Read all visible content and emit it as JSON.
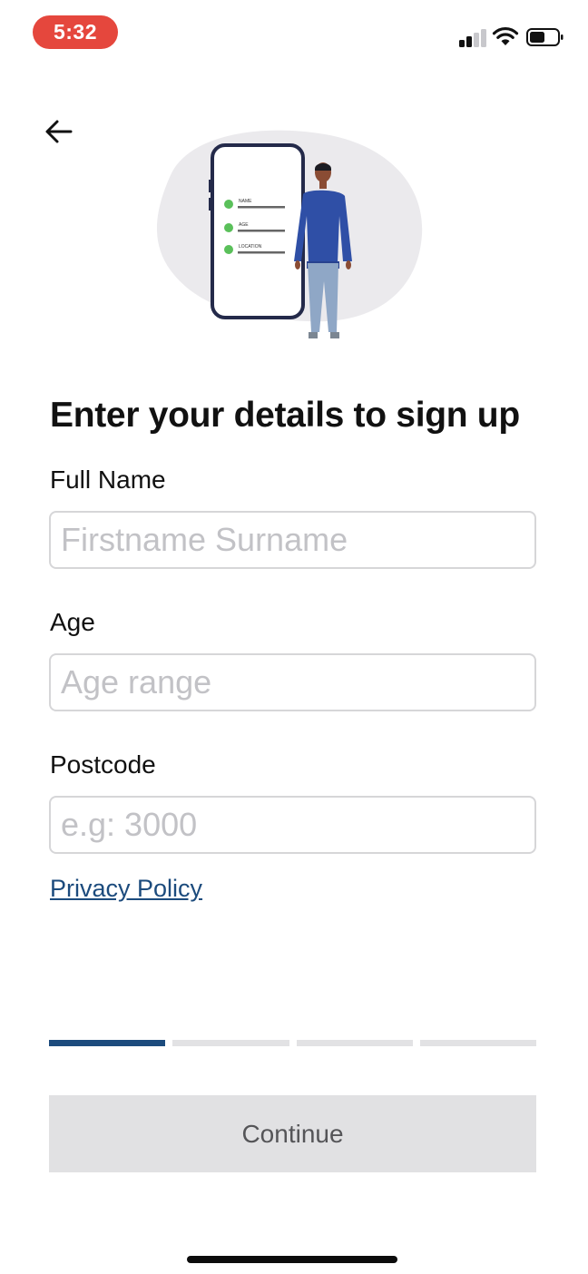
{
  "status_bar": {
    "time": "5:32",
    "icons": [
      "cellular-signal-icon",
      "wifi-icon",
      "battery-icon"
    ],
    "time_pill_color": "#e5473d"
  },
  "navigation": {
    "back_icon": "arrow-left-icon"
  },
  "illustration": {
    "checklist": [
      "NAME",
      "AGE",
      "LOCATION"
    ],
    "check_color": "#5ac05a"
  },
  "page": {
    "title": "Enter your details to sign up"
  },
  "form": {
    "full_name": {
      "label": "Full Name",
      "value": "",
      "placeholder": "Firstname Surname"
    },
    "age": {
      "label": "Age",
      "value": "",
      "placeholder": "Age range"
    },
    "postcode": {
      "label": "Postcode",
      "value": "",
      "placeholder": "e.g: 3000"
    }
  },
  "links": {
    "privacy_policy": "Privacy Policy"
  },
  "progress": {
    "total_steps": 4,
    "current_step": 1,
    "active_color": "#1c4b7d"
  },
  "actions": {
    "continue_label": "Continue"
  }
}
